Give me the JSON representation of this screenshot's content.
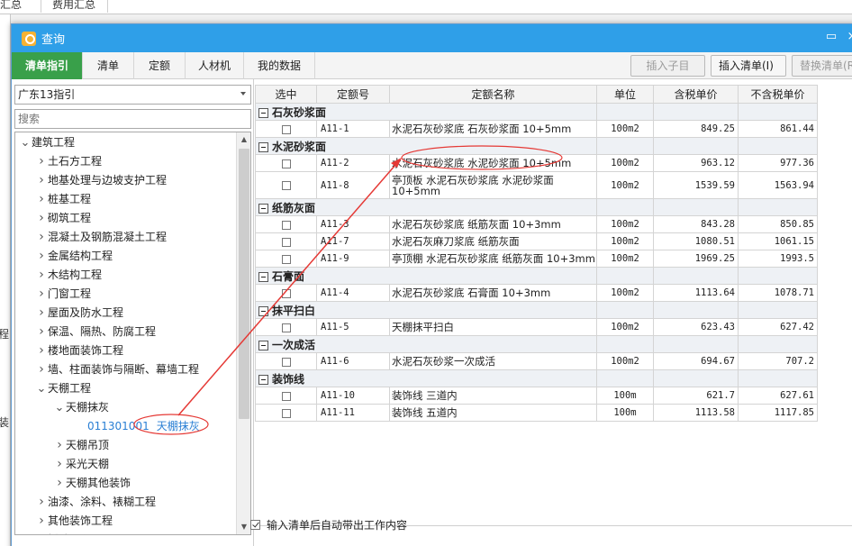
{
  "background": {
    "tabs": [
      "汇总",
      "费用汇总"
    ],
    "left_labels": [
      "程",
      "装"
    ]
  },
  "dialog": {
    "title": "查询",
    "minimize_glyph": "▭",
    "close_glyph": "×"
  },
  "tabs": [
    "清单指引",
    "清单",
    "定额",
    "人材机",
    "我的数据"
  ],
  "toolbar": {
    "insert_sub": "插入子目",
    "insert_list": "插入清单(I)",
    "replace_list": "替换清单(R)"
  },
  "left": {
    "combo_value": "广东13指引",
    "search_placeholder": "搜索",
    "tree": [
      {
        "label": "建筑工程",
        "level": 0,
        "arrow": "expanded"
      },
      {
        "label": "土石方工程",
        "level": 1,
        "arrow": "collapsed"
      },
      {
        "label": "地基处理与边坡支护工程",
        "level": 1,
        "arrow": "collapsed"
      },
      {
        "label": "桩基工程",
        "level": 1,
        "arrow": "collapsed"
      },
      {
        "label": "砌筑工程",
        "level": 1,
        "arrow": "collapsed"
      },
      {
        "label": "混凝土及钢筋混凝土工程",
        "level": 1,
        "arrow": "collapsed"
      },
      {
        "label": "金属结构工程",
        "level": 1,
        "arrow": "collapsed"
      },
      {
        "label": "木结构工程",
        "level": 1,
        "arrow": "collapsed"
      },
      {
        "label": "门窗工程",
        "level": 1,
        "arrow": "collapsed"
      },
      {
        "label": "屋面及防水工程",
        "level": 1,
        "arrow": "collapsed"
      },
      {
        "label": "保温、隔热、防腐工程",
        "level": 1,
        "arrow": "collapsed"
      },
      {
        "label": "楼地面装饰工程",
        "level": 1,
        "arrow": "collapsed"
      },
      {
        "label": "墙、柱面装饰与隔断、幕墙工程",
        "level": 1,
        "arrow": "collapsed"
      },
      {
        "label": "天棚工程",
        "level": 1,
        "arrow": "expanded"
      },
      {
        "label": "天棚抹灰",
        "level": 2,
        "arrow": "expanded"
      },
      {
        "label": "天棚抹灰",
        "code": "011301001",
        "level": 3,
        "arrow": "none",
        "selected": true
      },
      {
        "label": "天棚吊顶",
        "level": 2,
        "arrow": "collapsed"
      },
      {
        "label": "采光天棚",
        "level": 2,
        "arrow": "collapsed"
      },
      {
        "label": "天棚其他装饰",
        "level": 2,
        "arrow": "collapsed"
      },
      {
        "label": "油漆、涂料、裱糊工程",
        "level": 1,
        "arrow": "collapsed"
      },
      {
        "label": "其他装饰工程",
        "level": 1,
        "arrow": "collapsed"
      },
      {
        "label": "拆除工程",
        "level": 1,
        "arrow": "collapsed"
      }
    ]
  },
  "grid": {
    "headers": [
      "选中",
      "定额号",
      "定额名称",
      "单位",
      "含税单价",
      "不含税单价"
    ],
    "groups": [
      {
        "name": "石灰砂浆面",
        "rows": [
          {
            "code": "A11-1",
            "name": "水泥石灰砂浆底 石灰砂浆面 10+5mm",
            "unit": "100m2",
            "price_tax": "849.25",
            "price_notax": "861.44"
          }
        ]
      },
      {
        "name": "水泥砂浆面",
        "rows": [
          {
            "code": "A11-2",
            "name": "水泥石灰砂浆底 水泥砂浆面 10+5mm",
            "unit": "100m2",
            "price_tax": "963.12",
            "price_notax": "977.36"
          },
          {
            "code": "A11-8",
            "name": "亭顶板 水泥石灰砂浆底 水泥砂浆面 10+5mm",
            "unit": "100m2",
            "price_tax": "1539.59",
            "price_notax": "1563.94",
            "tall": true
          }
        ]
      },
      {
        "name": "纸筋灰面",
        "rows": [
          {
            "code": "A11-3",
            "name": "水泥石灰砂浆底 纸筋灰面 10+3mm",
            "unit": "100m2",
            "price_tax": "843.28",
            "price_notax": "850.85"
          },
          {
            "code": "A11-7",
            "name": "水泥石灰麻刀浆底 纸筋灰面",
            "unit": "100m2",
            "price_tax": "1080.51",
            "price_notax": "1061.15"
          },
          {
            "code": "A11-9",
            "name": "亭顶棚 水泥石灰砂浆底 纸筋灰面 10+3mm",
            "unit": "100m2",
            "price_tax": "1969.25",
            "price_notax": "1993.5"
          }
        ]
      },
      {
        "name": "石膏面",
        "rows": [
          {
            "code": "A11-4",
            "name": "水泥石灰砂浆底 石膏面 10+3mm",
            "unit": "100m2",
            "price_tax": "1113.64",
            "price_notax": "1078.71"
          }
        ]
      },
      {
        "name": "抹平扫白",
        "rows": [
          {
            "code": "A11-5",
            "name": "天棚抹平扫白",
            "unit": "100m2",
            "price_tax": "623.43",
            "price_notax": "627.42"
          }
        ]
      },
      {
        "name": "一次成活",
        "rows": [
          {
            "code": "A11-6",
            "name": "水泥石灰砂浆一次成活",
            "unit": "100m2",
            "price_tax": "694.67",
            "price_notax": "707.2"
          }
        ]
      },
      {
        "name": "装饰线",
        "rows": [
          {
            "code": "A11-10",
            "name": "装饰线 三道内",
            "unit": "100m",
            "price_tax": "621.7",
            "price_notax": "627.61"
          },
          {
            "code": "A11-11",
            "name": "装饰线 五道内",
            "unit": "100m",
            "price_tax": "1113.58",
            "price_notax": "1117.85"
          }
        ]
      }
    ]
  },
  "footer": {
    "auto_checkbox_label": "输入清单后自动带出工作内容",
    "auto_checked": true
  },
  "annotation": {
    "color": "#e53935"
  }
}
